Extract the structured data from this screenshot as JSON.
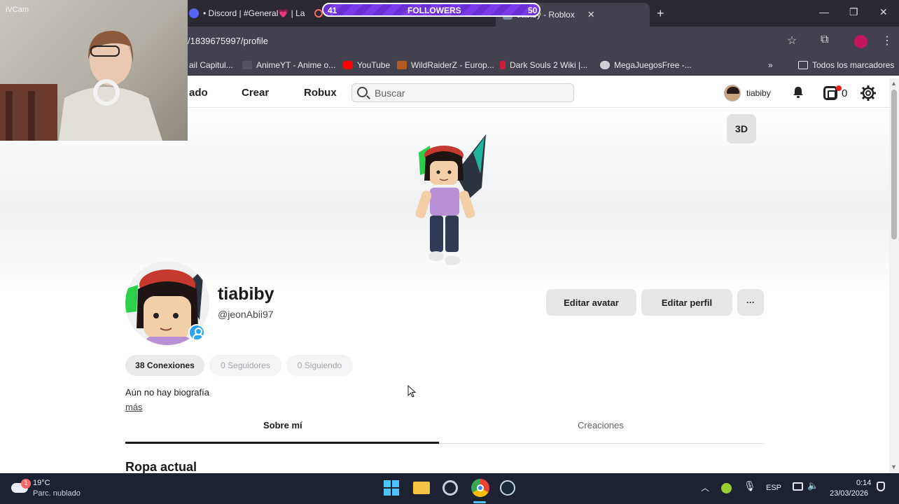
{
  "webcam": {
    "label": "iVCam"
  },
  "browser": {
    "tabs": [
      {
        "label": "• Discord | #General💗 | La"
      },
      {
        "label": "tiabiby - Roblox"
      }
    ],
    "followers": {
      "left": "41",
      "label": "FOLLOWERS",
      "right": "50"
    },
    "url": "/1839675997/profile",
    "bookmarks": [
      {
        "label": "ail Capitul..."
      },
      {
        "label": "AnimeYT - Anime o..."
      },
      {
        "label": "YouTube"
      },
      {
        "label": "WildRaiderZ - Europ..."
      },
      {
        "label": "Dark Souls 2 Wiki |..."
      },
      {
        "label": "MegaJuegosFree -..."
      },
      {
        "label": "Todos los marcadores"
      }
    ]
  },
  "roblox": {
    "nav": [
      {
        "label": "ado"
      },
      {
        "label": "Crear"
      },
      {
        "label": "Robux"
      }
    ],
    "search_placeholder": "Buscar",
    "header_username": "tiabiby",
    "robux_count": "0",
    "button_3d": "3D",
    "profile": {
      "display_name": "tiabiby",
      "handle": "@jeonAbii97",
      "edit_avatar": "Editar avatar",
      "edit_profile": "Editar perfil",
      "more_menu": "···",
      "stats": [
        {
          "label": "38 Conexiones",
          "active": true
        },
        {
          "label": "0 Seguidores",
          "active": false
        },
        {
          "label": "0 Siguiendo",
          "active": false
        }
      ],
      "bio": "Aún no hay biografía",
      "bio_more": "más",
      "tabs": [
        {
          "label": "Sobre mí",
          "active": true
        },
        {
          "label": "Creaciones",
          "active": false
        }
      ],
      "section_title": "Ropa actual"
    }
  },
  "taskbar": {
    "weather_temp": "19°C",
    "weather_desc": "Parc. nublado",
    "weather_badge": "1",
    "language": "ESP",
    "time": "0:14",
    "date": "23/03/2026"
  },
  "colors": {
    "accent_blue": "#29a3f2",
    "browser_dark": "#2b2a33",
    "taskbar": "#1d2233"
  }
}
